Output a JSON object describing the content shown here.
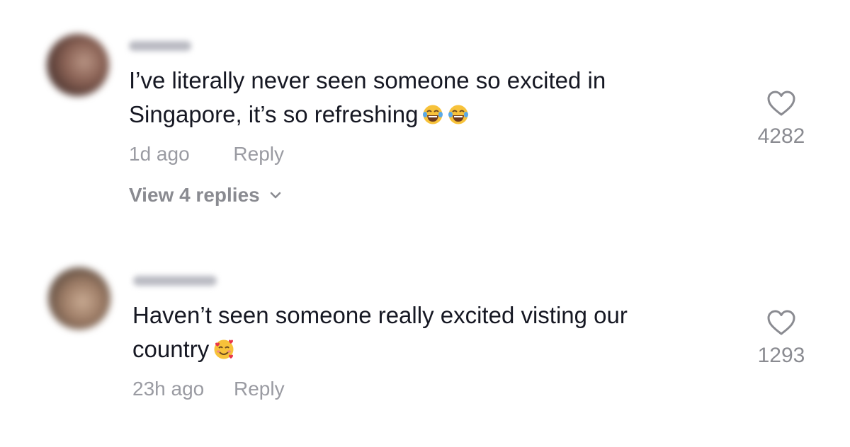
{
  "comments": [
    {
      "text_line_1": "I’ve literally never seen someone so excited in",
      "text_line_2": "Singapore, it’s so refreshing",
      "emojis": [
        "face-with-tears-of-joy",
        "face-with-tears-of-joy"
      ],
      "time": "1d ago",
      "reply_label": "Reply",
      "view_replies_label": "View 4 replies",
      "like_count": "4282"
    },
    {
      "text_line_1": "Haven’t seen someone really excited visting our",
      "text_line_2": "country",
      "emojis": [
        "smiling-face-with-hearts"
      ],
      "time": "23h ago",
      "reply_label": "Reply",
      "like_count": "1293"
    }
  ],
  "colors": {
    "text": "#161823",
    "meta": "#9a9ba2",
    "count": "#8a8b91",
    "emoji_yellow": "#f7c23a"
  }
}
